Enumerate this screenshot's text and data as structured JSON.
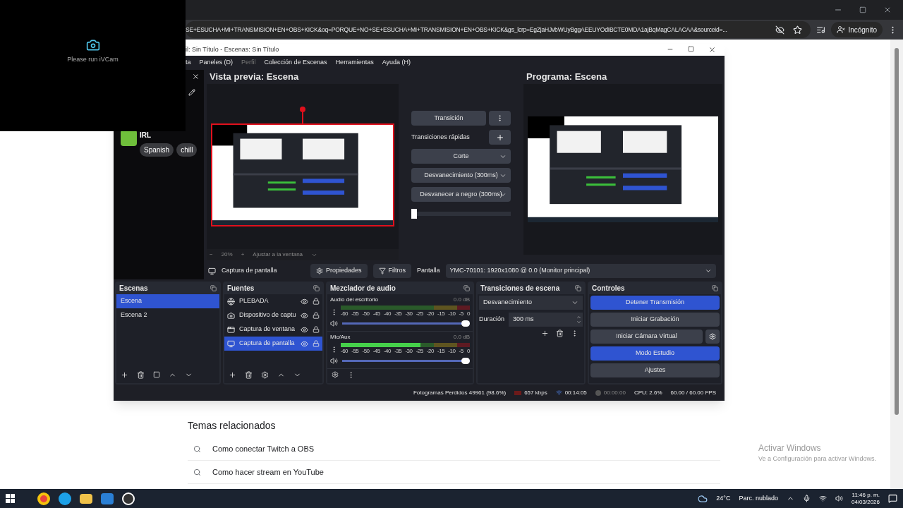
{
  "browser": {
    "address": "SE+ESUCHA+MI+TRANSMISION+EN+OBS+KICK&oq=PORQUE+NO+SE+ESUCHA+MI+TRANSMISION+EN+OBS+KICK&gs_lcrp=EgZjaHJvbWUyBggAEEUYOdIBCTE0MDA1ajBqMagCALACAA&sourceid=...",
    "profile": "Incógnito"
  },
  "ivcam": {
    "message": "Please run iVCam"
  },
  "obs": {
    "title": "il: Sin Título - Escenas: Sin Título",
    "menu": [
      {
        "label": "ta",
        "disabled": false
      },
      {
        "label": "Paneles (D)",
        "disabled": false
      },
      {
        "label": "Perfil",
        "disabled": true
      },
      {
        "label": "Colección de Escenas",
        "disabled": false
      },
      {
        "label": "Herramientas",
        "disabled": false
      },
      {
        "label": "Ayuda (H)",
        "disabled": false
      }
    ],
    "side_dock": {
      "channel": "IRL",
      "tags": [
        "Spanish",
        "chill"
      ]
    },
    "preview": {
      "title": "Vista previa: Escena",
      "zoom": "20%",
      "fit": "Ajustar a la ventana",
      "minus": "−",
      "plus": "+"
    },
    "center": {
      "transition": "Transición",
      "quick_label": "Transiciones rápidas",
      "quick": [
        "Corte",
        "Desvanecimiento (300ms)",
        "Desvanecer a negro (300ms)"
      ],
      "tbar": {
        "level": 0
      }
    },
    "program": {
      "title": "Programa: Escena"
    },
    "context": {
      "source": "Captura de pantalla",
      "properties": "Propiedades",
      "filters": "Filtros",
      "display_label": "Pantalla",
      "display_value": "YMC-70101: 1920x1080 @ 0.0 (Monitor principal)"
    },
    "scenes": {
      "title": "Escenas",
      "items": [
        {
          "name": "Escena",
          "selected": true
        },
        {
          "name": "Escena 2",
          "selected": false
        }
      ]
    },
    "sources": {
      "title": "Fuentes",
      "items": [
        {
          "name": "PLEBADA",
          "kind": "browser",
          "selected": false
        },
        {
          "name": "Dispositivo de captu",
          "kind": "camera",
          "selected": false
        },
        {
          "name": "Captura de ventana",
          "kind": "window",
          "selected": false
        },
        {
          "name": "Captura de pantalla",
          "kind": "display",
          "selected": true
        }
      ]
    },
    "mixer": {
      "title": "Mezclador de audio",
      "channels": [
        {
          "name": "Audio del escritorio",
          "reading": "0.0 dB",
          "volume": {
            "level": 1
          },
          "scale": [
            "-60",
            "-55",
            "-50",
            "-45",
            "-40",
            "-35",
            "-30",
            "-25",
            "-20",
            "-15",
            "-10",
            "-5",
            "0"
          ]
        },
        {
          "name": "Mic/Aux",
          "reading": "0.0 dB",
          "meter": {
            "level": 0.62
          },
          "volume": {
            "level": 1
          },
          "scale": [
            "-60",
            "-55",
            "-50",
            "-45",
            "-40",
            "-35",
            "-30",
            "-25",
            "-20",
            "-15",
            "-10",
            "-5",
            "0"
          ]
        }
      ]
    },
    "transitions": {
      "title": "Transiciones de escena",
      "selected": "Desvanecimiento",
      "duration_label": "Duración",
      "duration": "300 ms"
    },
    "controls": {
      "title": "Controles",
      "buttons": [
        {
          "label": "Detener Transmisión",
          "active": true,
          "gear": false
        },
        {
          "label": "Iniciar Grabación",
          "active": false,
          "gear": false
        },
        {
          "label": "Iniciar Cámara Virtual",
          "active": false,
          "gear": true
        },
        {
          "label": "Modo Estudio",
          "active": true,
          "gear": false
        },
        {
          "label": "Ajustes",
          "active": false,
          "gear": false
        }
      ]
    },
    "status": {
      "dropped": "Fotogramas Perdidos 49961 (98.6%)",
      "bitrate": "657 kbps",
      "stream_time": "00:14:05",
      "record_time": "00:00:00",
      "cpu": "CPU: 2.6%",
      "fps": "60.00 / 60.00 FPS"
    }
  },
  "page": {
    "heading": "Temas relacionados",
    "suggestions": [
      "Como conectar Twitch a OBS",
      "Como hacer stream en YouTube"
    ],
    "activation_title": "Activar Windows",
    "activation_text": "Ve a Configuración para activar Windows."
  },
  "taskbar": {
    "temperature": "24°C",
    "weather": "Parc. nublado",
    "time": "11:46 p. m.",
    "date": "04/03/2026"
  }
}
